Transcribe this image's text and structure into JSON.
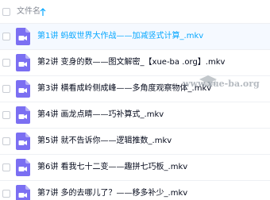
{
  "header": {
    "label": "文件名"
  },
  "colors": {
    "accent": "#06a7ff",
    "file_icon": "#7b6ff2",
    "text": "#03081a",
    "muted": "#878c96",
    "row_highlight_bg": "#f5f9ff"
  },
  "files": [
    {
      "name": "第1讲 蚂蚁世界大作战——加减竖式计算_.mkv",
      "icon": "video-file-icon"
    },
    {
      "name": "第2讲 变身的数——图文解密_【xue-ba .org】.mkv",
      "icon": "video-file-icon"
    },
    {
      "name": "第3讲 横看成岭侧成峰——多角度观察物体_.mkv",
      "icon": "video-file-icon"
    },
    {
      "name": "第4讲 画龙点睛——巧补算式_.mkv",
      "icon": "video-file-icon"
    },
    {
      "name": "第5讲 就不告诉你——逻辑推数_.mkv",
      "icon": "video-file-icon"
    },
    {
      "name": "第6讲 看我七十二变——趣拼七巧板_.mkv",
      "icon": "video-file-icon"
    },
    {
      "name": "第7讲 多的去哪儿了？——移多补少_.mkv",
      "icon": "video-file-icon"
    }
  ],
  "watermark": {
    "text": "www.xue-ba.org"
  }
}
